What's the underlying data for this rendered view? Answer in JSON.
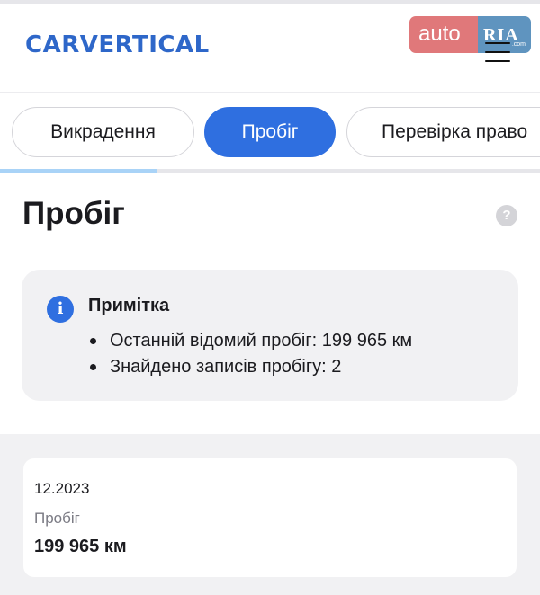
{
  "header": {
    "logo": "CARVERTICAL",
    "watermark": {
      "auto": "auto",
      "ria": "RIA",
      "com": ".com"
    }
  },
  "tabs": [
    {
      "label": "Викрадення",
      "active": false
    },
    {
      "label": "Пробіг",
      "active": true
    },
    {
      "label": "Перевірка право",
      "active": false
    }
  ],
  "progress": {
    "fraction": 0.29
  },
  "section": {
    "title": "Пробіг",
    "help_icon": "question-icon"
  },
  "note": {
    "icon": "info-icon",
    "title": "Примітка",
    "items": [
      "Останній відомий пробіг: 199 965 км",
      "Знайдено записів пробігу: 2"
    ]
  },
  "records": [
    {
      "date": "12.2023",
      "label": "Пробіг",
      "value": "199 965 км"
    }
  ],
  "colors": {
    "accent": "#2f6fe0",
    "logo": "#2e67c9",
    "progress": "#a9d3f7",
    "card_bg": "#f1f1f3"
  }
}
